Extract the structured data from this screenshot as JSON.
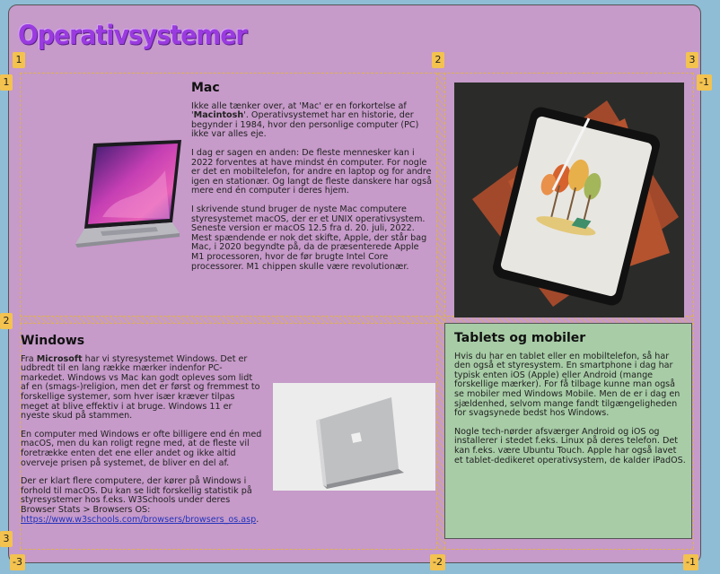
{
  "page": {
    "title": "Operativsystemer"
  },
  "mac": {
    "heading": "Mac",
    "p1_pre": "Ikke alle tænker over, at 'Mac' er en forkortelse af '",
    "p1_bold": "Macintosh",
    "p1_post": "'. Operativsystemet har en historie, der begynder i 1984, hvor den personlige computer (PC) ikke var alles eje.",
    "p2": "I dag er sagen en anden: De fleste mennesker kan i 2022 forventes at have mindst én computer. For nogle er det en mobiltelefon, for andre en laptop og for andre igen en stationær. Og langt de fleste danskere har også mere end én computer i deres hjem.",
    "p3": "I skrivende stund bruger de nyste Mac computere styresystemet macOS, der er et UNIX operativsystem. Seneste version er macOS 12.5 fra d. 20. juli, 2022. Mest spændende er nok det skifte, Apple, der står bag Mac, i 2020 begyndte på, da de præsenterede Apple M1 processoren, hvor de før brugte Intel Core processorer. M1 chippen skulle være revolutionær."
  },
  "windows": {
    "heading": "Windows",
    "p1_pre": "Fra ",
    "p1_bold": "Microsoft",
    "p1_post": " har vi styresystemet Windows. Det er udbredt til en lang række mærker indenfor PC-markedet. Windows vs Mac kan godt opleves som lidt af en (smags-)religion, men det er først og fremmest to forskellige systemer, som hver især kræver tilpas meget at blive effektiv i at bruge. Windows 11 er nyeste skud på stammen.",
    "p2": "En computer med Windows er ofte billigere end én med macOS, men du kan roligt regne med, at de fleste vil foretrække enten det ene eller andet og ikke altid overveje prisen på systemet, de bliver en del af.",
    "p3": "Der er klart flere computere, der kører på Windows i forhold til macOS. Du kan se lidt forskellig statistik på styresystemer hos f.eks. W3Schools under deres Browser Stats > Browsers OS:",
    "link": "https://www.w3schools.com/browsers/browsers_os.asp",
    "link_end": "."
  },
  "tablets": {
    "heading": "Tablets og mobiler",
    "p1": "Hvis du har en tablet eller en mobiltelefon, så har den også et styresystem. En smartphone i dag har typisk enten iOS (Apple) eller Android (mange forskellige mærker). For få tilbage kunne man også se mobiler med Windows Mobile. Men de er i dag en sjældenhed, selvom mange fandt tilgængeligheden for svagsynede bedst hos Windows.",
    "p2": "Nogle tech-nørder afsværger Android og iOS og installerer i stedet f.eks. Linux på deres telefon. Det kan f.eks. være Ubuntu Touch. Apple har også lavet et tablet-dedikeret operativsystem, de kalder iPadOS."
  },
  "grid_badges": {
    "top": [
      "1",
      "2",
      "3"
    ],
    "row_top": [
      "1",
      "-1"
    ],
    "mid": "2",
    "left_bottom": "3",
    "bottom": [
      "-3",
      "-2",
      "-1"
    ]
  },
  "colors": {
    "page_bg": "#8fbdd6",
    "panel_bg": "#c69ac9",
    "title": "#9a3be0",
    "green_panel": "#a7cca6",
    "grid_line": "#e0b24a"
  }
}
